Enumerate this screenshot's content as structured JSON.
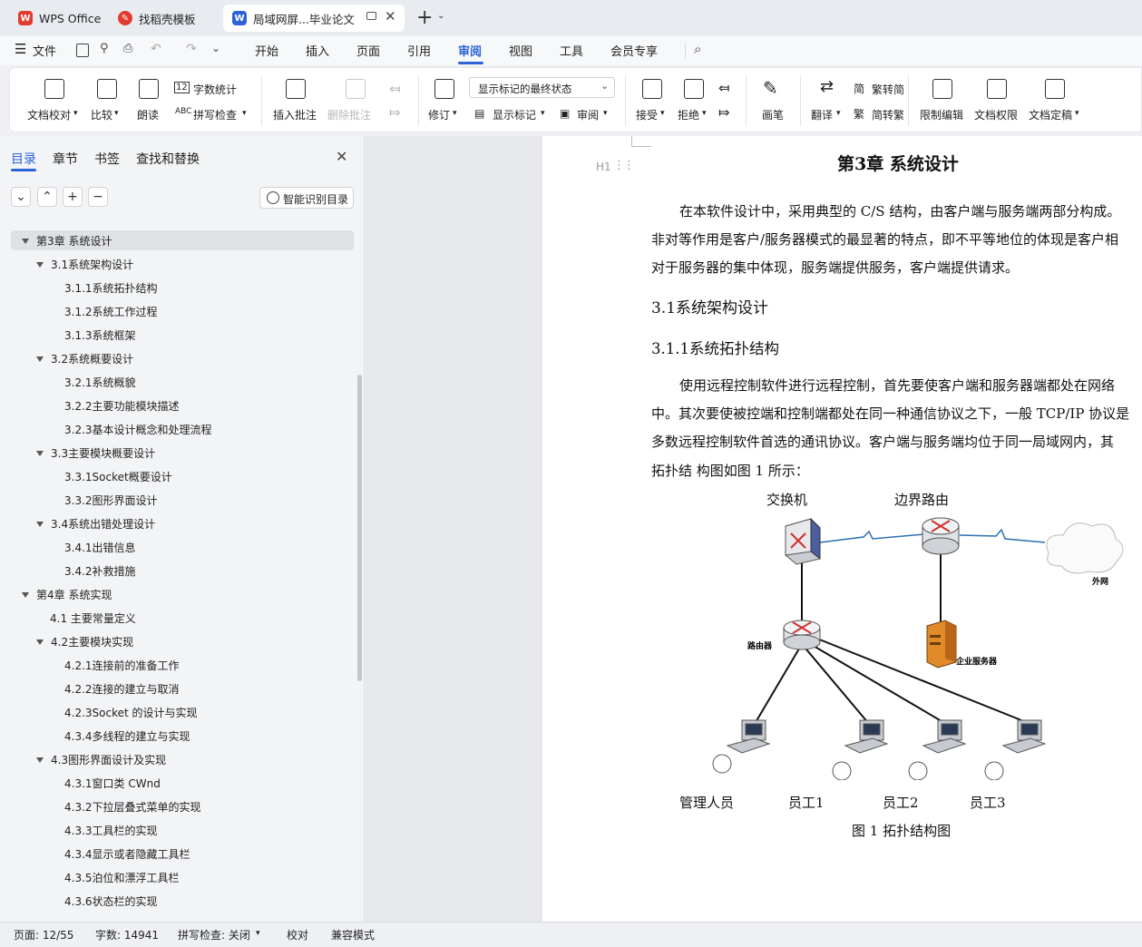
{
  "tabs": [
    {
      "label": "WPS Office"
    },
    {
      "label": "找稻壳模板"
    },
    {
      "label": "局域网屏...毕业论文"
    }
  ],
  "menu": {
    "file": "文件",
    "items": [
      "开始",
      "插入",
      "页面",
      "引用",
      "审阅",
      "视图",
      "工具",
      "会员专享"
    ],
    "active": "审阅"
  },
  "ribbon": {
    "doc_check": "文档校对",
    "compare": "比较",
    "read_aloud": "朗读",
    "word_count": "字数统计",
    "spell_check": "拼写检查",
    "insert_comment": "插入批注",
    "delete_comment": "删除批注",
    "revise": "修订",
    "markup_state": "显示标记的最终状态",
    "show_markup": "显示标记",
    "review": "审阅",
    "accept": "接受",
    "reject": "拒绝",
    "pen": "画笔",
    "translate": "翻译",
    "to_traditional": "繁转简",
    "to_simplified": "简转繁",
    "restrict_edit": "限制编辑",
    "doc_permission": "文档权限",
    "doc_finalize": "文档定稿"
  },
  "nav": {
    "tabs": [
      "目录",
      "章节",
      "书签",
      "查找和替换"
    ],
    "smart_toc": "智能识别目录",
    "items": [
      {
        "label": "第3章 系统设计",
        "level": 0,
        "expanded": true,
        "selected": true
      },
      {
        "label": "3.1系统架构设计",
        "level": 1,
        "expanded": true
      },
      {
        "label": "3.1.1系统拓扑结构",
        "level": 2
      },
      {
        "label": "3.1.2系统工作过程",
        "level": 2
      },
      {
        "label": "3.1.3系统框架",
        "level": 2
      },
      {
        "label": "3.2系统概要设计",
        "level": 1,
        "expanded": true
      },
      {
        "label": "3.2.1系统概貌",
        "level": 2
      },
      {
        "label": "3.2.2主要功能模块描述",
        "level": 2
      },
      {
        "label": "3.2.3基本设计概念和处理流程",
        "level": 2
      },
      {
        "label": "3.3主要模块概要设计",
        "level": 1,
        "expanded": true
      },
      {
        "label": "3.3.1Socket概要设计",
        "level": 2
      },
      {
        "label": "3.3.2图形界面设计",
        "level": 2
      },
      {
        "label": "3.4系统出错处理设计",
        "level": 1,
        "expanded": true
      },
      {
        "label": "3.4.1出错信息",
        "level": 2
      },
      {
        "label": "3.4.2补救措施",
        "level": 2
      },
      {
        "label": "第4章 系统实现",
        "level": 0,
        "expanded": true
      },
      {
        "label": "4.1 主要常量定义",
        "level": 1
      },
      {
        "label": "4.2主要模块实现",
        "level": 1,
        "expanded": true
      },
      {
        "label": "4.2.1连接前的准备工作",
        "level": 2
      },
      {
        "label": "4.2.2连接的建立与取消",
        "level": 2
      },
      {
        "label": "4.2.3Socket 的设计与实现",
        "level": 2
      },
      {
        "label": "4.3.4多线程的建立与实现",
        "level": 2
      },
      {
        "label": "4.3图形界面设计及实现",
        "level": 1,
        "expanded": true
      },
      {
        "label": "4.3.1窗口类 CWnd",
        "level": 2
      },
      {
        "label": "4.3.2下拉层叠式菜单的实现",
        "level": 2
      },
      {
        "label": "4.3.3工具栏的实现",
        "level": 2
      },
      {
        "label": "4.3.4显示或者隐藏工具栏",
        "level": 2
      },
      {
        "label": "4.3.5泊位和漂浮工具栏",
        "level": 2
      },
      {
        "label": "4.3.6状态栏的实现",
        "level": 2
      }
    ]
  },
  "doc": {
    "heading_marker": "H1",
    "chapter_title": "第3章 系统设计",
    "para1": [
      "在本软件设计中，采用典型的 C/S 结构，由客户端与服务端两部分构成。",
      "非对等作用是客户/服务器模式的最显著的特点，即不平等地位的体现是客户相",
      "对于服务器的集中体现，服务端提供服务，客户端提供请求。"
    ],
    "h2": "3.1系统架构设计",
    "h3": "3.1.1系统拓扑结构",
    "para2": [
      "使用远程控制软件进行远程控制，首先要使客户端和服务器端都处在网络",
      "中。其次要使被控端和控制端都处在同一种通信协议之下，一般 TCP/IP 协议是",
      "多数远程控制软件首选的通讯协议。客户端与服务端均位于同一局域网内，其",
      "拓扑结 构图如图 1 所示："
    ],
    "figure": {
      "switch": "交换机",
      "border_router": "边界路由",
      "internet": "外网",
      "router": "路由器",
      "server": "企业服务器",
      "manager": "管理人员",
      "staff1": "员工1",
      "staff2": "员工2",
      "staff3": "员工3",
      "caption": "图 1 拓扑结构图"
    }
  },
  "status": {
    "page": "页面: 12/55",
    "words": "字数: 14941",
    "spell": "拼写检查: 关闭",
    "proof": "校对",
    "compat": "兼容模式"
  },
  "colors": {
    "accent": "#2b64d6",
    "wps_red": "#e23b2f"
  }
}
